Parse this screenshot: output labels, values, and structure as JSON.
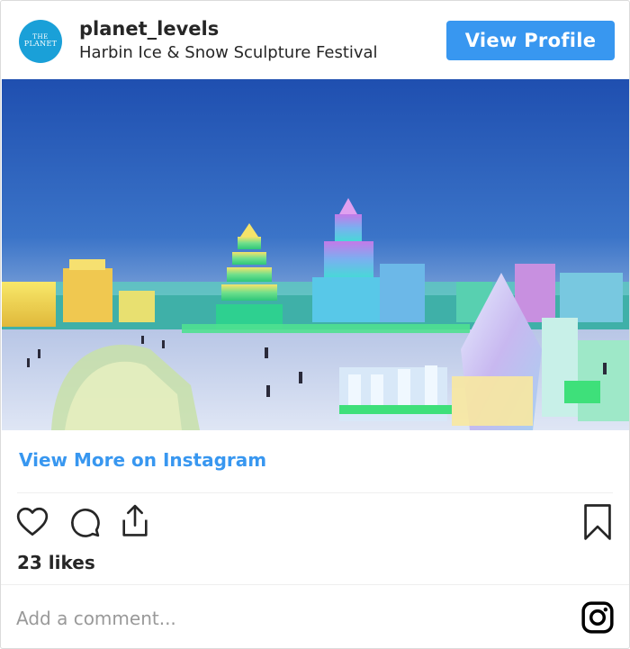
{
  "post": {
    "avatar_text_line1": "THE",
    "avatar_text_line2": "PLANET",
    "username": "planet_levels",
    "location": "Harbin Ice & Snow Sculpture Festival",
    "view_profile_label": "View Profile"
  },
  "media": {
    "description": "panorama-ice-sculpture-festival"
  },
  "footer": {
    "view_more_label": "View More on Instagram",
    "likes": "23 likes",
    "comment_placeholder": "Add a comment..."
  },
  "icons": {
    "like": "heart-icon",
    "comment": "comment-bubble-icon",
    "share": "share-icon",
    "save": "bookmark-icon",
    "brand": "instagram-icon"
  },
  "colors": {
    "accent": "#3897f0",
    "text": "#262626",
    "avatar_bg": "#1aa0d8"
  }
}
